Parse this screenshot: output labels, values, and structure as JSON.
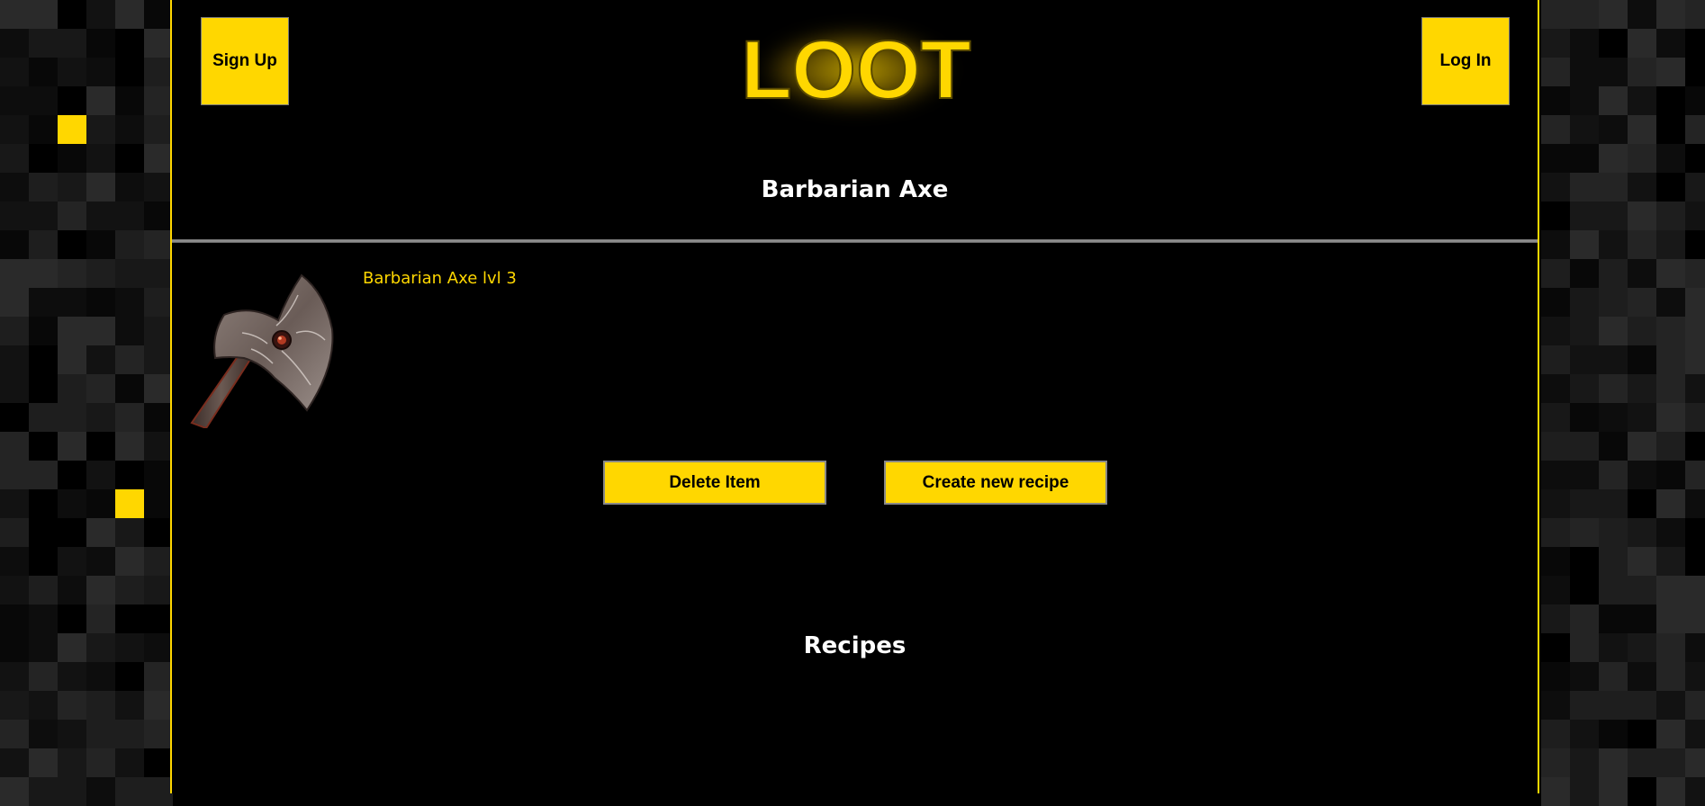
{
  "header": {
    "logo_text": "LOOT",
    "signup_label": "Sign Up",
    "login_label": "Log In"
  },
  "page": {
    "title": "Barbarian Axe"
  },
  "item": {
    "name": "Barbarian Axe lvl 3",
    "image_icon": "axe-icon"
  },
  "actions": {
    "delete_label": "Delete Item",
    "create_recipe_label": "Create new recipe"
  },
  "recipes": {
    "heading": "Recipes"
  },
  "colors": {
    "accent": "#ffd700",
    "background": "#000000",
    "text": "#ffffff"
  }
}
